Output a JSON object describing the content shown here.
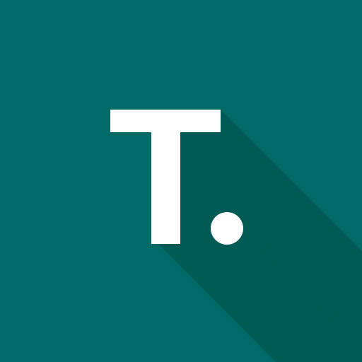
{
  "logo": {
    "icon": "letter-t-dot-logo",
    "letter": "T",
    "background_color": "#006b66",
    "shadow_color": "#005a56",
    "glyph_color": "#ffffff"
  }
}
